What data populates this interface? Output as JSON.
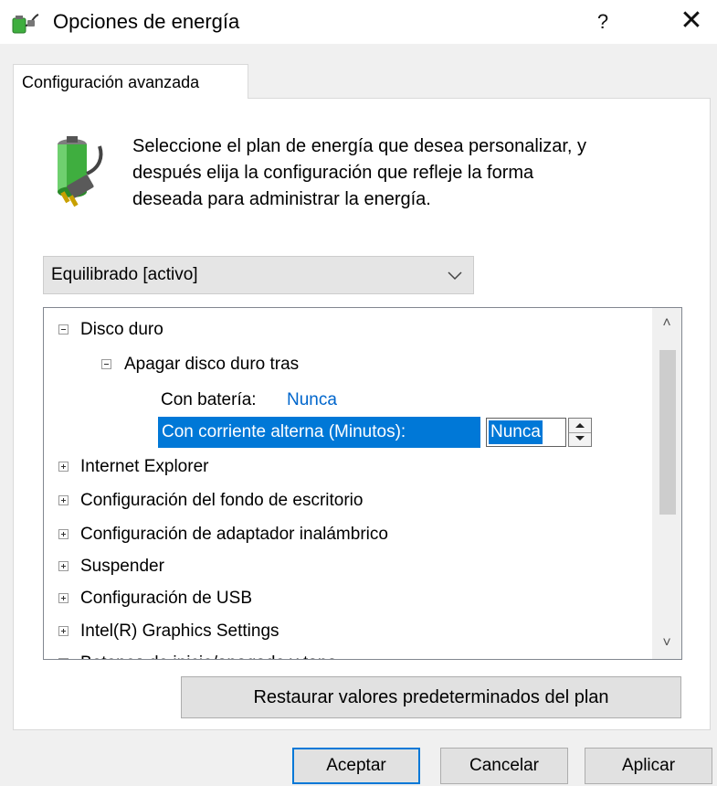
{
  "window": {
    "title": "Opciones de energía",
    "help_label": "?",
    "close_label": "✕"
  },
  "tab": {
    "label": "Configuración avanzada"
  },
  "description": {
    "line1": "Seleccione el plan de energía que desea personalizar, y",
    "line2": "después elija la configuración que refleje la forma",
    "line3": "deseada para administrar la energía."
  },
  "plan_select": {
    "value": "Equilibrado [activo]"
  },
  "tree": {
    "items": [
      {
        "label": "Disco duro"
      },
      {
        "label": "Apagar disco duro tras"
      },
      {
        "label": "Con batería:",
        "value": "Nunca"
      },
      {
        "label": "Con corriente alterna (Minutos):",
        "value": "Nunca"
      },
      {
        "label": "Internet Explorer"
      },
      {
        "label": "Configuración del fondo de escritorio"
      },
      {
        "label": "Configuración de adaptador inalámbrico"
      },
      {
        "label": "Suspender"
      },
      {
        "label": "Configuración de USB"
      },
      {
        "label": "Intel(R) Graphics Settings"
      },
      {
        "label": "Botones de inicio/apagado y tapa"
      }
    ],
    "scroll_up": "˄",
    "scroll_down": "˅"
  },
  "buttons": {
    "restore": "Restaurar valores predeterminados del plan",
    "ok": "Aceptar",
    "cancel": "Cancelar",
    "apply": "Aplicar"
  },
  "colors": {
    "selection": "#0078d7",
    "link_value": "#0066cc",
    "battery_green": "#3fae3f"
  },
  "icons": {
    "app": "power-plug-battery-icon",
    "header": "battery-plug-icon"
  }
}
